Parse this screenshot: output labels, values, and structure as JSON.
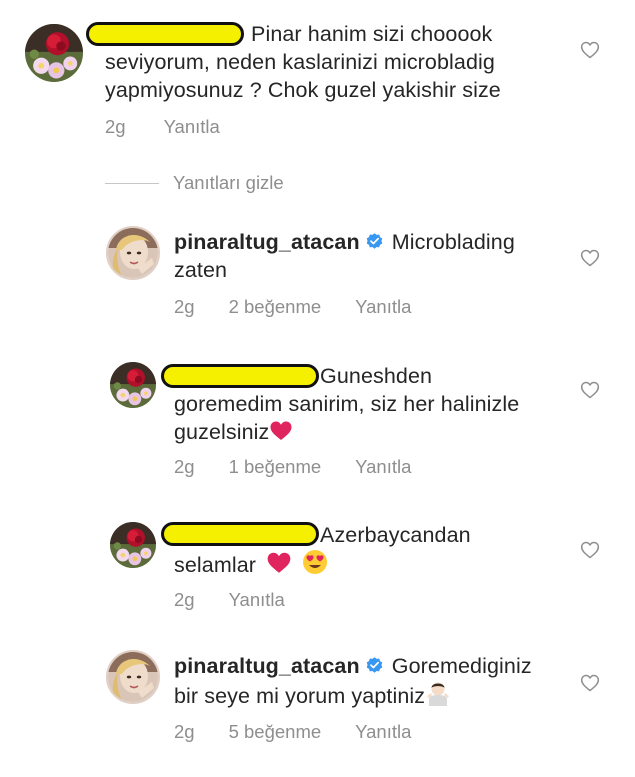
{
  "comments": [
    {
      "text_line1": "Pinar hanim sizi chooook",
      "text_line2": "seviyorum, neden kaslarinizi microbladig",
      "text_line3": "yapmiyosunuz ? Chok guzel yakishir size",
      "time": "2g",
      "reply_label": "Yanıtla"
    }
  ],
  "hide_replies_label": "Yanıtları gizle",
  "replies": [
    {
      "username": "pinaraltug_atacan",
      "text_line1": "Microblading",
      "text_line2": "zaten",
      "time": "2g",
      "likes": "2 beğenme",
      "reply_label": "Yanıtla"
    },
    {
      "text_line1": "Guneshden",
      "text_line2": "goremedim sanirim, siz her halinizle",
      "text_line3": "guzelsiniz",
      "time": "2g",
      "likes": "1 beğenme",
      "reply_label": "Yanıtla"
    },
    {
      "text_line1": "Azerbaycandan",
      "text_line2": "selamlar",
      "time": "2g",
      "reply_label": "Yanıtla"
    },
    {
      "username": "pinaraltug_atacan",
      "text_line1": "Goremediginiz",
      "text_line2": "bir seye mi yorum yaptiniz",
      "time": "2g",
      "likes": "5 beğenme",
      "reply_label": "Yanıtla"
    }
  ],
  "colors": {
    "highlight": "#f4f000",
    "verified": "#3897f0",
    "muted": "#8e8e8e",
    "heart_emoji": "#e0245e"
  },
  "icons": [
    "heart-outline-icon",
    "verified-badge-icon",
    "red-heart-emoji",
    "heart-eyes-emoji",
    "person-shrugging-emoji"
  ]
}
